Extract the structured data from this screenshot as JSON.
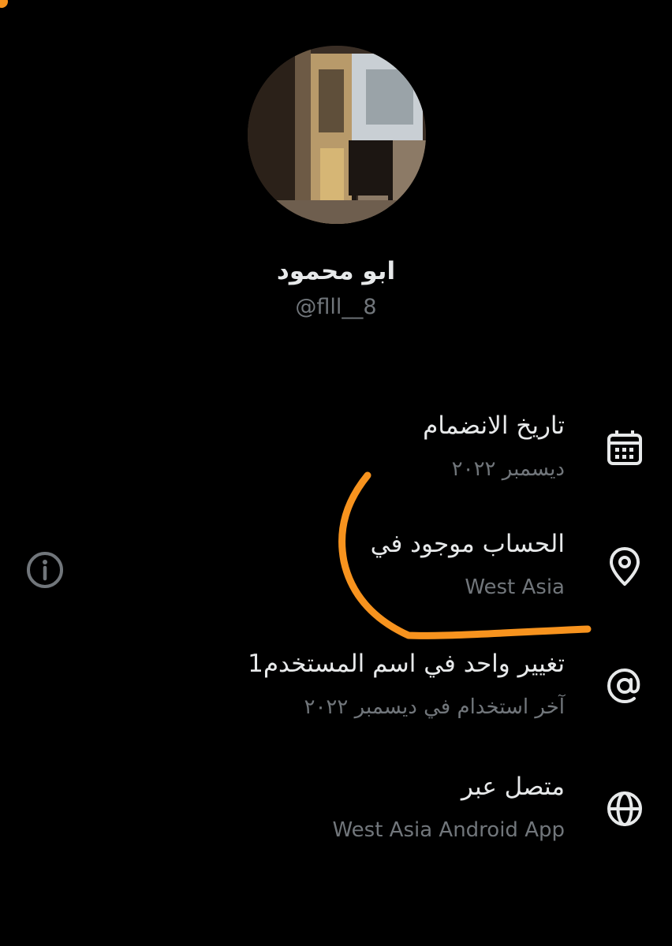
{
  "profile": {
    "display_name": "ابو محمود",
    "handle": "@flll__8",
    "avatar_icon": "profile-photo"
  },
  "rows": [
    {
      "icon": "calendar-icon",
      "title": "تاريخ الانضمام",
      "value": "ديسمبر ٢٠٢٢"
    },
    {
      "icon": "location-pin-icon",
      "title": "الحساب موجود في",
      "value": "West Asia"
    },
    {
      "icon": "at-sign-icon",
      "title": "تغيير واحد في اسم المستخدم1",
      "value": "آخر استخدام في ديسمبر ٢٠٢٢"
    },
    {
      "icon": "globe-icon",
      "title": "متصل عبر",
      "value": "West Asia Android App"
    }
  ],
  "info_button": {
    "icon": "info-icon"
  },
  "colors": {
    "background": "#000000",
    "primary_text": "#e7e9ea",
    "secondary_text": "#71767b",
    "annotation": "#f7931e"
  }
}
